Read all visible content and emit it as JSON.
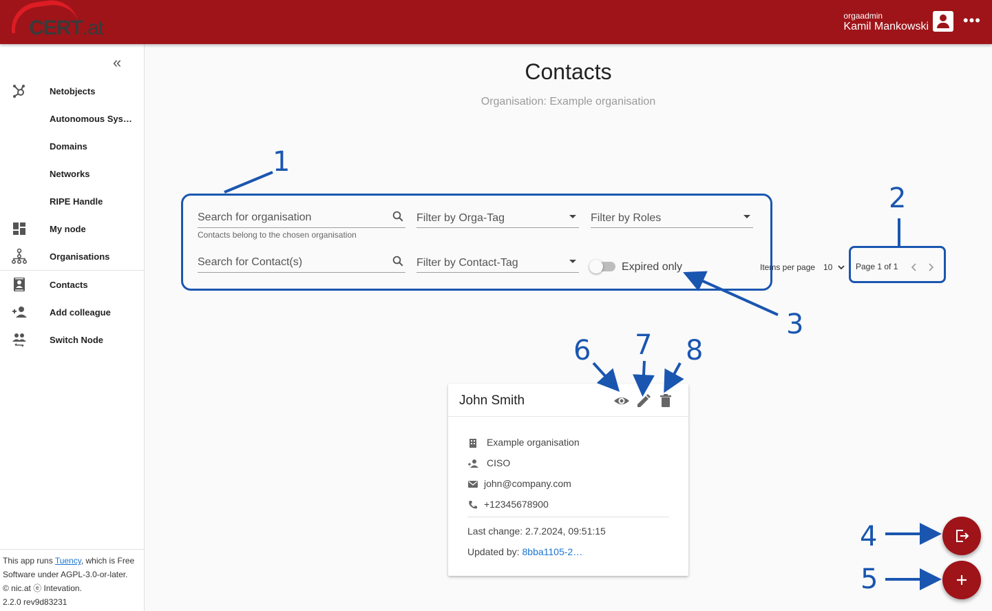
{
  "header": {
    "logo_text": "CERT",
    "logo_suffix": ".at",
    "user_role": "orgaadmin",
    "user_name": "Kamil Mankowski",
    "menu_glyph": "•••"
  },
  "sidebar": {
    "collapse_glyph": "«",
    "items": [
      {
        "label": "Netobjects",
        "icon": "hub-icon"
      },
      {
        "label": "Autonomous Systems",
        "icon": ""
      },
      {
        "label": "Domains",
        "icon": ""
      },
      {
        "label": "Networks",
        "icon": ""
      },
      {
        "label": "RIPE Handle",
        "icon": ""
      },
      {
        "label": "My node",
        "icon": "dashboard-icon"
      },
      {
        "label": "Organisations",
        "icon": "org-tree-icon"
      },
      {
        "label": "Contacts",
        "icon": "contact-card-icon"
      },
      {
        "label": "Add colleague",
        "icon": "person-add-icon"
      },
      {
        "label": "Switch Node",
        "icon": "switch-people-icon"
      }
    ],
    "footer": {
      "pre": "This app runs ",
      "link": "Tuency",
      "post": ", which is Free Software under AGPL-3.0-or-later.",
      "copyright": "© nic.at ⓔ Intevation.",
      "version": "2.2.0 rev9d83231"
    }
  },
  "main": {
    "title": "Contacts",
    "subtitle": "Organisation: Example organisation",
    "filters": {
      "search_org_placeholder": "Search for organisation",
      "search_org_hint": "Contacts belong to the chosen organisation",
      "orga_tag_placeholder": "Filter by Orga-Tag",
      "roles_placeholder": "Filter by Roles",
      "search_contact_placeholder": "Search for Contact(s)",
      "contact_tag_placeholder": "Filter by Contact-Tag",
      "expired_label": "Expired only",
      "expired_on": false
    },
    "pagination": {
      "items_per_page_label": "Items per page",
      "items_per_page": "10",
      "page_label": "Page 1 of 1"
    },
    "card": {
      "name": "John Smith",
      "organisation": "Example organisation",
      "role": "CISO",
      "email": "john@company.com",
      "phone": "+12345678900",
      "last_change": "Last change: 2.7.2024, 09:51:15",
      "updated_by_label": "Updated by:",
      "updated_by": "8bba1105-2…"
    }
  },
  "annotations": [
    "1",
    "2",
    "3",
    "4",
    "5",
    "6",
    "7",
    "8"
  ],
  "colors": {
    "brand": "#9e1419",
    "annotation": "#1a56b0",
    "link": "#1976d2"
  }
}
